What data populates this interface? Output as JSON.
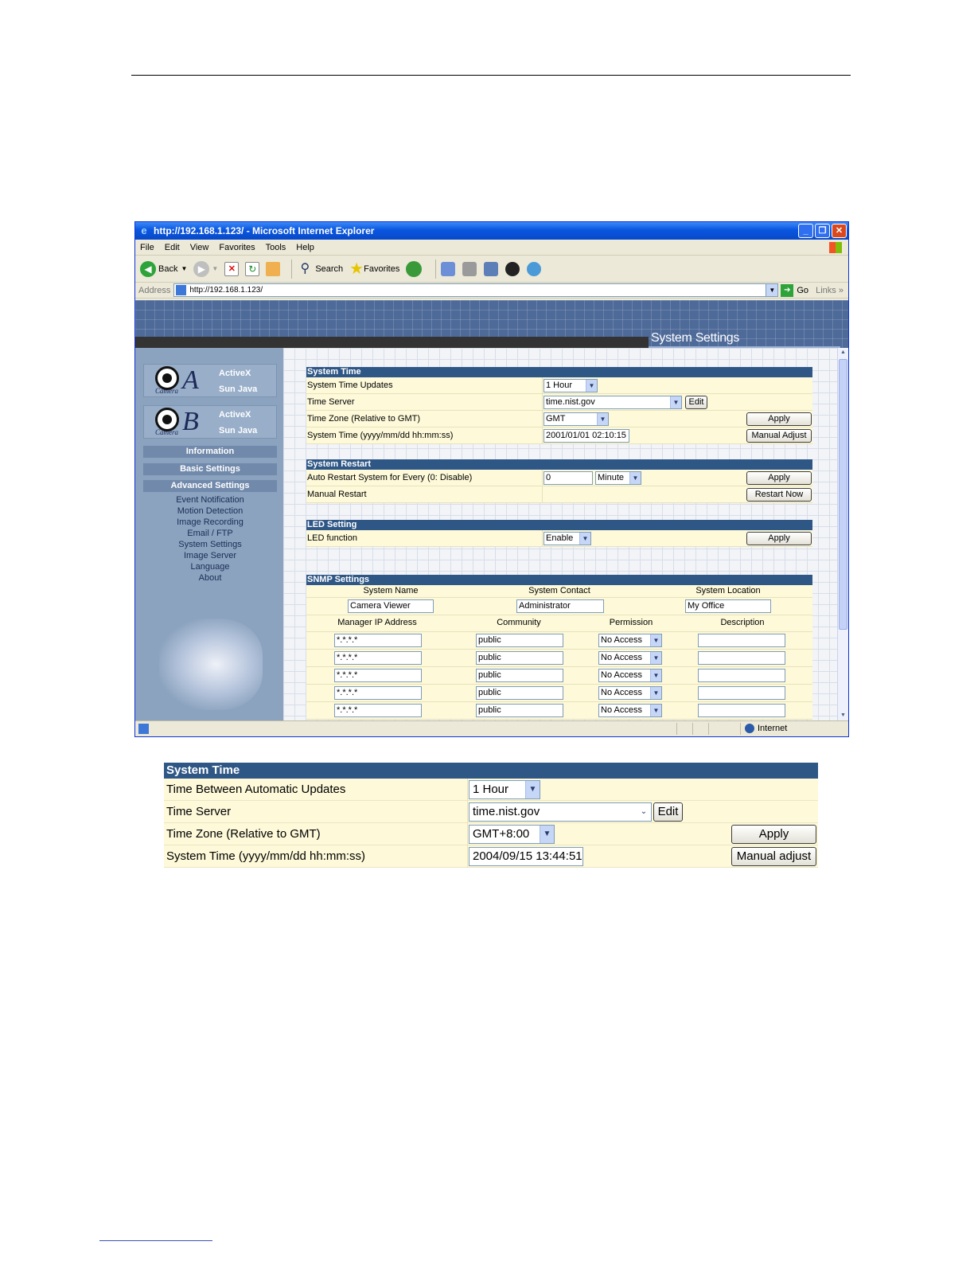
{
  "window": {
    "title": "http://192.168.1.123/ - Microsoft Internet Explorer",
    "menu": [
      "File",
      "Edit",
      "View",
      "Favorites",
      "Tools",
      "Help"
    ],
    "toolbar": {
      "back": "Back",
      "search": "Search",
      "favorites": "Favorites"
    },
    "address_label": "Address",
    "address_url": "http://192.168.1.123/",
    "go_label": "Go",
    "links_label": "Links",
    "status_zone": "Internet"
  },
  "banner": {
    "title": "System Settings"
  },
  "sidebar": {
    "camera_a": {
      "letter": "A",
      "word": "Camera",
      "link1": "ActiveX",
      "link2": "Sun Java"
    },
    "camera_b": {
      "letter": "B",
      "word": "Camera",
      "link1": "ActiveX",
      "link2": "Sun Java"
    },
    "information": "Information",
    "basic_settings": "Basic Settings",
    "advanced_settings": "Advanced Settings",
    "links": [
      "Event Notification",
      "Motion Detection",
      "Image Recording",
      "Email / FTP",
      "System Settings",
      "Image Server",
      "Language",
      "About"
    ]
  },
  "system_time": {
    "header": "System Time",
    "updates_label": "System Time Updates",
    "updates_value": "1 Hour",
    "server_label": "Time Server",
    "server_value": "time.nist.gov",
    "edit_button": "Edit",
    "zone_label": "Time Zone (Relative to GMT)",
    "zone_value": "GMT",
    "apply_button": "Apply",
    "time_label": "System Time (yyyy/mm/dd hh:mm:ss)",
    "time_value": "2001/01/01 02:10:15",
    "manual_button": "Manual Adjust"
  },
  "system_restart": {
    "header": "System Restart",
    "auto_label": "Auto Restart System for Every (0: Disable)",
    "auto_value": "0",
    "unit_value": "Minute",
    "apply_button": "Apply",
    "manual_label": "Manual Restart",
    "restart_button": "Restart Now"
  },
  "led": {
    "header": "LED Setting",
    "label": "LED function",
    "value": "Enable",
    "apply_button": "Apply"
  },
  "snmp": {
    "header": "SNMP Settings",
    "col_name": "System Name",
    "col_contact": "System Contact",
    "col_location": "System Location",
    "name_value": "Camera Viewer",
    "contact_value": "Administrator",
    "location_value": "My Office",
    "col_ip": "Manager IP Address",
    "col_community": "Community",
    "col_permission": "Permission",
    "col_description": "Description",
    "managers": [
      {
        "ip": "*.*.*.*",
        "community": "public",
        "permission": "No Access",
        "description": ""
      },
      {
        "ip": "*.*.*.*",
        "community": "public",
        "permission": "No Access",
        "description": ""
      },
      {
        "ip": "*.*.*.*",
        "community": "public",
        "permission": "No Access",
        "description": ""
      },
      {
        "ip": "*.*.*.*",
        "community": "public",
        "permission": "No Access",
        "description": ""
      },
      {
        "ip": "*.*.*.*",
        "community": "public",
        "permission": "No Access",
        "description": ""
      }
    ]
  },
  "detail_panel": {
    "header": "System Time",
    "updates_label": "Time Between Automatic Updates",
    "updates_value": "1 Hour",
    "server_label": "Time Server",
    "server_value": "time.nist.gov",
    "edit_button": "Edit",
    "zone_label": "Time Zone (Relative to GMT)",
    "zone_value": "GMT+8:00",
    "apply_button": "Apply",
    "time_label": "System Time (yyyy/mm/dd hh:mm:ss)",
    "time_value": "2004/09/15 13:44:51",
    "manual_button": "Manual adjust"
  }
}
